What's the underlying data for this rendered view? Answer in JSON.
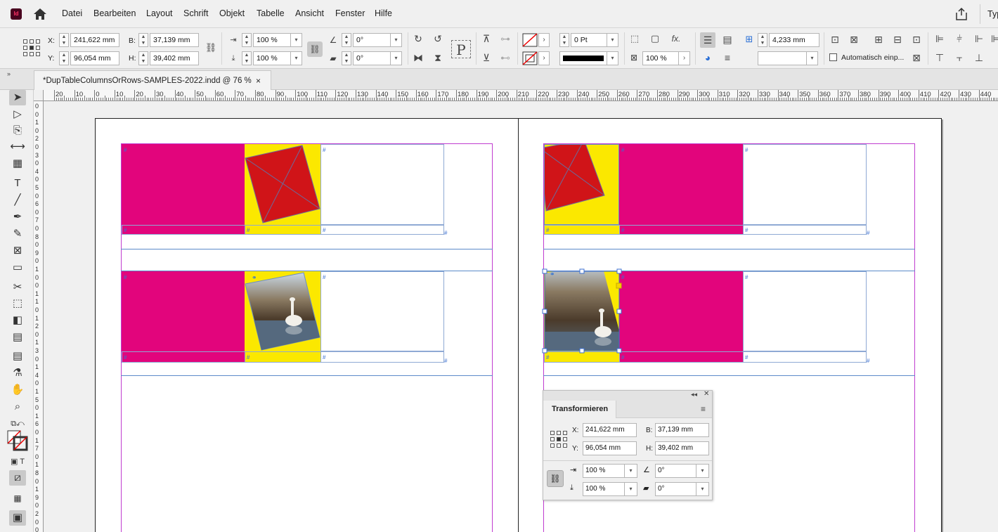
{
  "app": {
    "logo_text": "Id",
    "right_label": "Typ"
  },
  "menu": [
    "Datei",
    "Bearbeiten",
    "Layout",
    "Schrift",
    "Objekt",
    "Tabelle",
    "Ansicht",
    "Fenster",
    "Hilfe"
  ],
  "control": {
    "x_label": "X:",
    "x_value": "241,622 mm",
    "y_label": "Y:",
    "y_value": "96,054 mm",
    "w_label": "B:",
    "w_value": "37,139 mm",
    "h_label": "H:",
    "h_value": "39,402 mm",
    "scale_x": "100 %",
    "scale_y": "100 %",
    "rotate": "0°",
    "shear": "0°",
    "stroke_weight": "0 Pt",
    "opacity": "100 %",
    "frame_value": "4,233 mm",
    "autofit_label": "Automatisch einp..."
  },
  "document_tab": {
    "title": "*DupTableColumnsOrRows-SAMPLES-2022.indd @ 76 %",
    "close": "×"
  },
  "ruler_h": [
    "20",
    "10",
    "0",
    "10",
    "20",
    "30",
    "40",
    "50",
    "60",
    "70",
    "80",
    "90",
    "100",
    "110",
    "120",
    "130",
    "140",
    "150",
    "160",
    "170",
    "180",
    "190",
    "200",
    "210",
    "220",
    "230",
    "240",
    "250",
    "260",
    "270",
    "280",
    "290",
    "300",
    "310",
    "320",
    "330",
    "340",
    "350",
    "360",
    "370",
    "380",
    "390",
    "400",
    "410",
    "420",
    "430",
    "440"
  ],
  "ruler_v": [
    "0",
    "0",
    "1",
    "0",
    "2",
    "0",
    "3",
    "0",
    "4",
    "0",
    "5",
    "0",
    "6",
    "0",
    "7",
    "0",
    "8",
    "0",
    "9",
    "0",
    "1",
    "0",
    "0",
    "1",
    "1",
    "0",
    "1",
    "2",
    "0",
    "1",
    "3",
    "0",
    "1",
    "4",
    "0",
    "1",
    "5",
    "0",
    "1",
    "6",
    "0",
    "1",
    "7",
    "0",
    "1",
    "8",
    "0",
    "1",
    "9",
    "0",
    "2",
    "0",
    "0"
  ],
  "cell_marker": "#",
  "transform_panel": {
    "title": "Transformieren",
    "x_label": "X:",
    "x_value": "241,622 mm",
    "y_label": "Y:",
    "y_value": "96,054 mm",
    "w_label": "B:",
    "w_value": "37,139 mm",
    "h_label": "H:",
    "h_value": "39,402 mm",
    "scale_x": "100 %",
    "scale_y": "100 %",
    "rotate": "0°",
    "shear": "0°"
  },
  "colors": {
    "magenta": "#e2057c",
    "yellow": "#fbe800",
    "red": "#d01418",
    "frame_blue": "#5b8ac9",
    "margin_purple": "#c03ccf"
  }
}
